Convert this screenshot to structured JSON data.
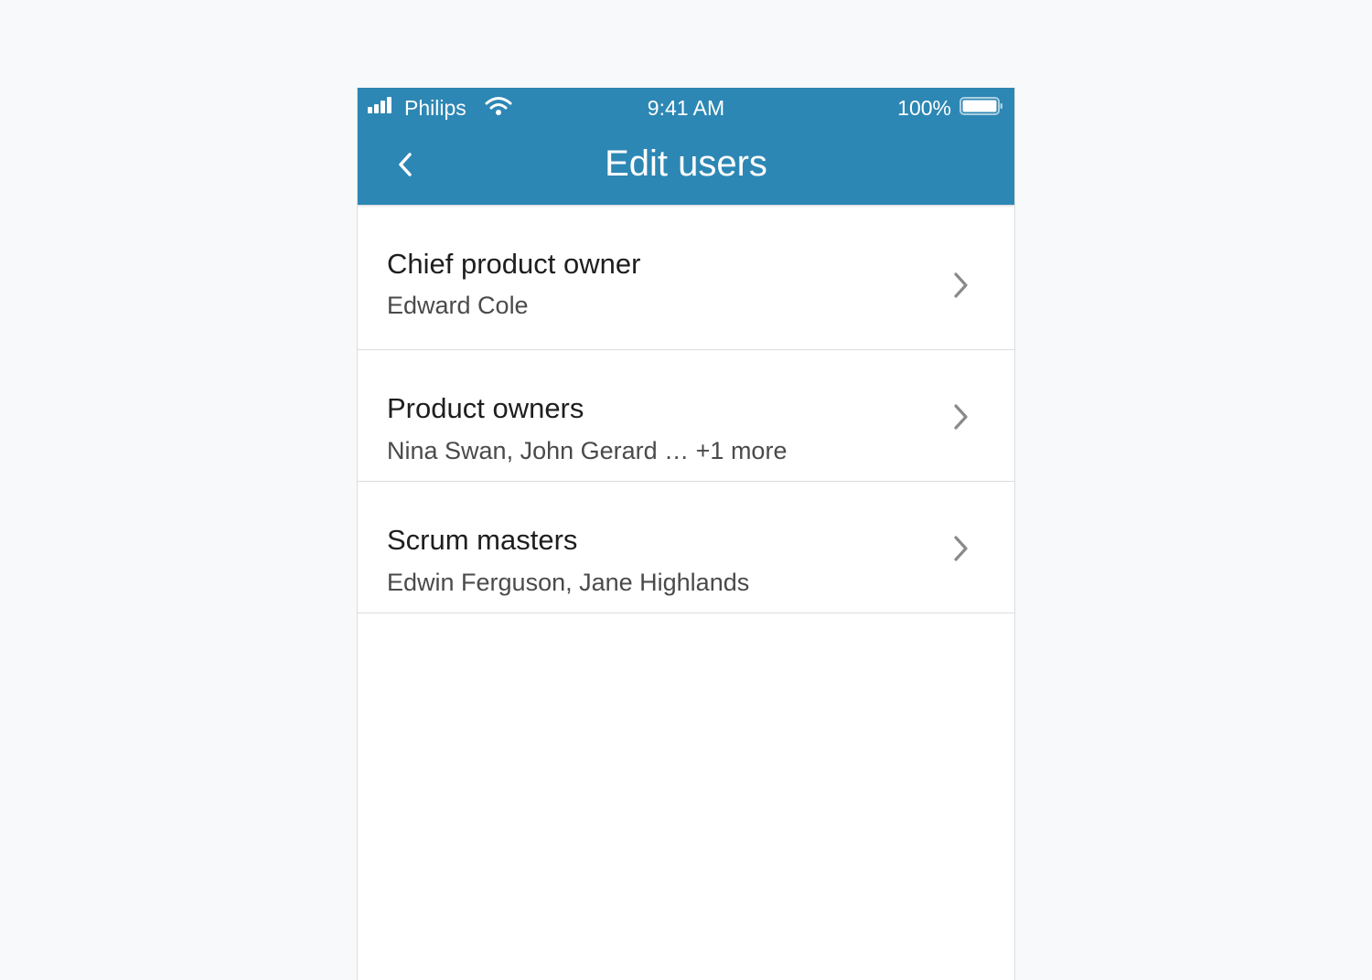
{
  "status_bar": {
    "carrier": "Philips",
    "time": "9:41 AM",
    "battery": "100%"
  },
  "nav": {
    "title": "Edit users"
  },
  "roles": [
    {
      "label": "Chief product owner",
      "users": "Edward Cole"
    },
    {
      "label": "Product owners",
      "users": "Nina Swan, John Gerard … +1 more"
    },
    {
      "label": "Scrum masters",
      "users": "Edwin Ferguson, Jane Highlands"
    }
  ],
  "colors": {
    "header": "#2d87b4",
    "background": "#f8f9fb",
    "divider": "#dddddd",
    "chevron": "#8a8a8a"
  },
  "icons": {
    "signal": "cellular-signal-icon",
    "wifi": "wifi-icon",
    "battery": "battery-icon",
    "back": "chevron-left-icon",
    "row_arrow": "chevron-right-icon"
  }
}
